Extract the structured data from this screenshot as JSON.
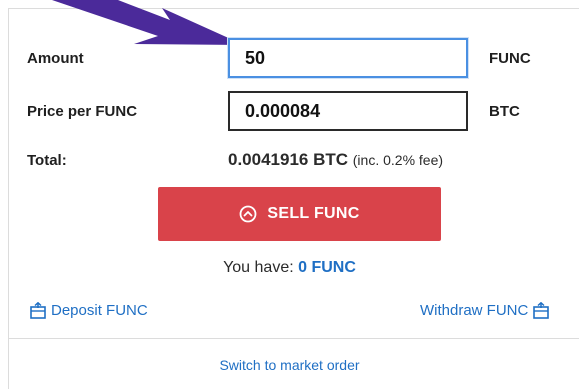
{
  "form": {
    "amount_label": "Amount",
    "amount_value": "50",
    "amount_unit": "FUNC",
    "price_label": "Price per FUNC",
    "price_value": "0.000084",
    "price_unit": "BTC",
    "total_label": "Total:",
    "total_value": "0.0041916 BTC",
    "total_fee": "(inc. 0.2% fee)"
  },
  "actions": {
    "sell_label": "SELL FUNC",
    "sell_icon": "chevron-up-circle-icon"
  },
  "balance": {
    "prefix": "You have:",
    "amount": "0 FUNC"
  },
  "links": {
    "deposit": "Deposit FUNC",
    "withdraw": "Withdraw FUNC",
    "switch": "Switch to market order"
  },
  "colors": {
    "sell": "#d9434a",
    "link": "#1f6fc4",
    "focus": "#4a90e2",
    "pointer": "#4b2a9a"
  }
}
